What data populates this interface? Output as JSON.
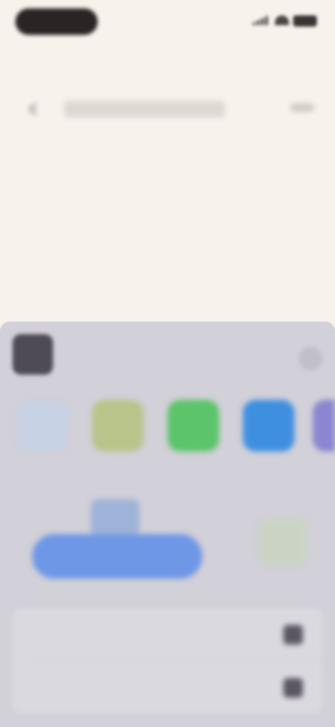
{
  "status_bar": {
    "time": ""
  },
  "page": {
    "title": "",
    "url": "",
    "headline": ""
  },
  "share_sheet": {
    "title": "",
    "subtitle": "",
    "apps": [
      {
        "label": ""
      },
      {
        "label": ""
      },
      {
        "label": ""
      },
      {
        "label": ""
      },
      {
        "label": ""
      }
    ],
    "copy_label": "",
    "options": [
      {
        "label": ""
      },
      {
        "label": ""
      }
    ]
  },
  "colors": {
    "page_background": "#f7f2ec",
    "sheet_background": "#d2d0d8",
    "accent_blue": "#2f5fc4",
    "copy_button": "#6e97e6"
  },
  "icons": [
    "back-icon",
    "menu-icon",
    "close-icon",
    "airdrop-icon",
    "notes-icon",
    "messages-icon",
    "mail-icon",
    "copy-icon"
  ]
}
